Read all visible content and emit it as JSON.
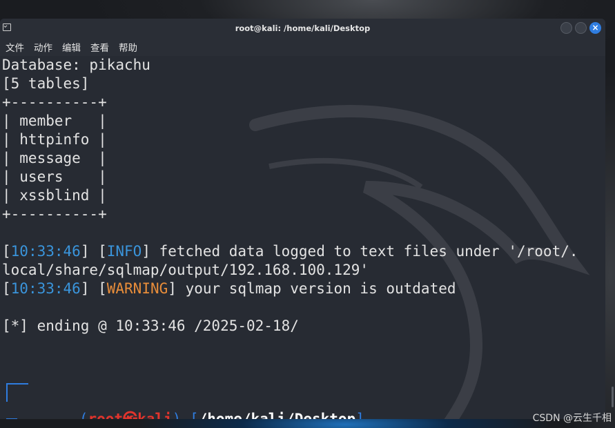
{
  "window": {
    "title": "root@kali: /home/kali/Desktop",
    "close_glyph": "×"
  },
  "menu": [
    "文件",
    "动作",
    "编辑",
    "查看",
    "帮助"
  ],
  "terminal": {
    "lines": [
      "Database: pikachu",
      "[5 tables]",
      "+----------+",
      "| member   |",
      "| httpinfo |",
      "| message  |",
      "| users    |",
      "| xssblind |",
      "+----------+",
      ""
    ],
    "log": [
      {
        "open": "[",
        "time": "10:33:46",
        "mid": "] [",
        "level": "INFO",
        "close": "] ",
        "msg": "fetched data logged to text files under '/root/."
      },
      {
        "plain": "local/share/sqlmap/output/192.168.100.129'"
      },
      {
        "open": "[",
        "time": "10:33:46",
        "mid": "] [",
        "level": "WARNING",
        "close": "] ",
        "msg": "your sqlmap version is outdated"
      }
    ],
    "ending": "[*] ending @ 10:33:46 /2025-02-18/",
    "prompt": {
      "open_paren": "(",
      "user": "root",
      "skull": "㉿",
      "host": "kali",
      "close_paren": ")",
      "dash": "-",
      "open_bracket": "[",
      "path": "/home/kali/Desktop",
      "close_bracket": "]",
      "symbol": "#"
    }
  },
  "colors": {
    "info": "#3a95dc",
    "warning": "#e88d3a",
    "prompt_user": "#e2342c",
    "prompt_lines": "#2f7de0",
    "background": "#272b33"
  },
  "watermark": "CSDN @云生千相"
}
